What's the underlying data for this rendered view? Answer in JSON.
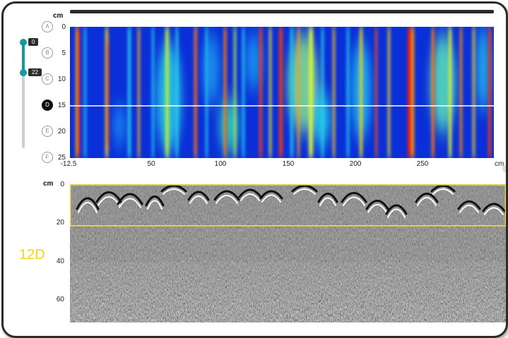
{
  "top_plot": {
    "y_unit": "cm",
    "x_unit": "cm",
    "y_ticks": [
      "0",
      "5",
      "10",
      "15",
      "20",
      "25"
    ],
    "x_ticks": [
      "-12.5",
      "50",
      "100",
      "150",
      "200",
      "250"
    ],
    "marker_labels": [
      "A",
      "B",
      "C",
      "D",
      "E",
      "F"
    ],
    "active_marker": "D"
  },
  "depth_slider": {
    "min_value": "0",
    "max_value": "22"
  },
  "bottom_plot": {
    "y_unit": "cm",
    "y_ticks": [
      "0",
      "20",
      "40",
      "60"
    ],
    "scan_id": "12D"
  },
  "colors": {
    "slider_accent": "#139aa0",
    "highlight_box": "#f5e23a",
    "scan_label": "#f5d90a"
  }
}
